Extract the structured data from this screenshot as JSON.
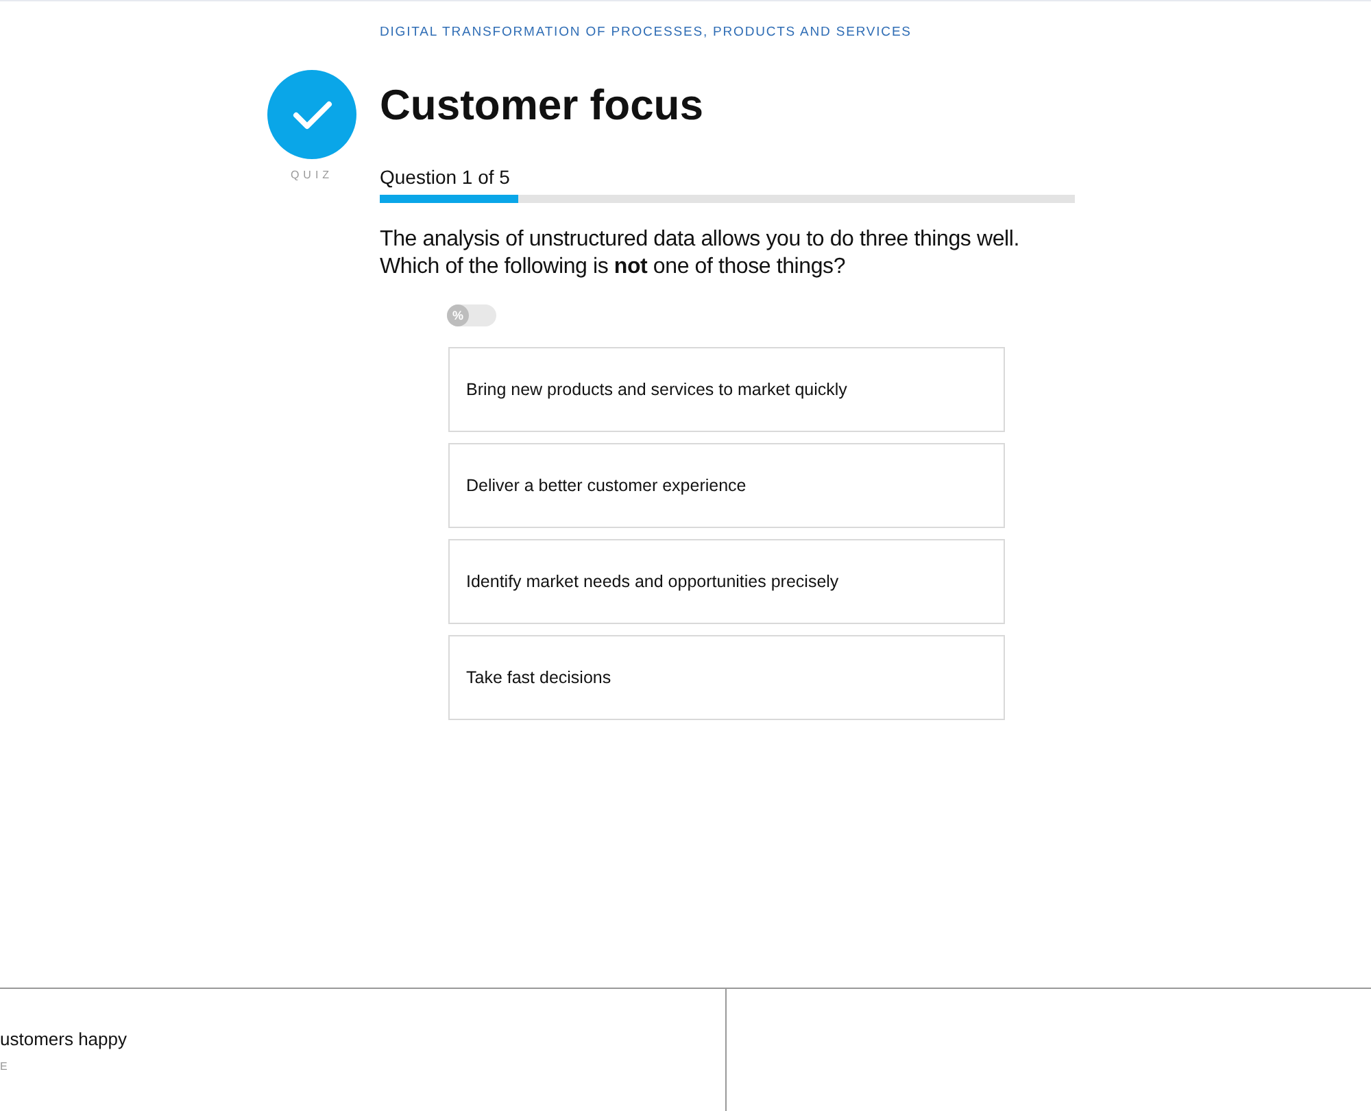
{
  "header": {
    "course": "DIGITAL TRANSFORMATION OF PROCESSES, PRODUCTS AND SERVICES"
  },
  "lesson": {
    "type_label": "QUIZ",
    "title": "Customer focus",
    "completed": true
  },
  "progress": {
    "label": "Question 1 of 5",
    "level": 0.2
  },
  "question": {
    "text": "The analysis of unstructured data allows you to do three things well. Which of the following is **not** one of those things?"
  },
  "percent_toggle": {
    "label": "%",
    "on": false
  },
  "answers": [
    {
      "text": "Bring new products and services to market quickly",
      "selected": false
    },
    {
      "text": "Deliver a better customer experience",
      "selected": false
    },
    {
      "text": "Identify market needs and opportunities precisely",
      "selected": false
    },
    {
      "text": "Take fast decisions",
      "selected": false
    }
  ],
  "next_lessons": [
    {
      "title": "ustomers happy",
      "type_label": "E"
    }
  ]
}
